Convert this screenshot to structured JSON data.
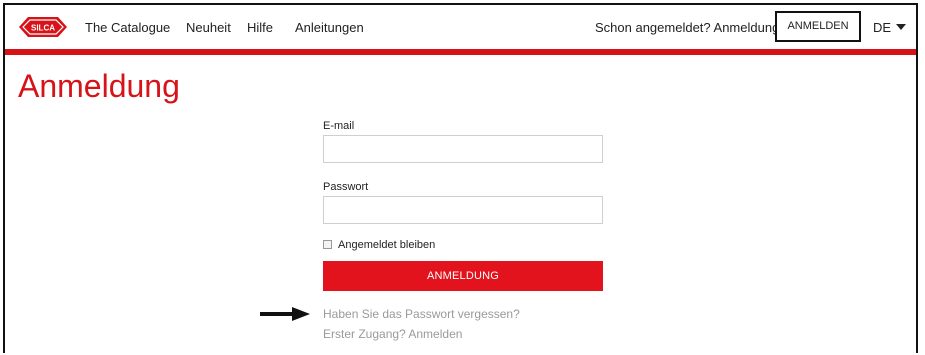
{
  "nav": {
    "logo_text": "SILCA",
    "items": [
      "The Catalogue",
      "Neuheit",
      "Hilfe",
      "Anleitungen"
    ],
    "already_logged": "Schon angemeldet? Anmeldung",
    "login_button": "ANMELDEN",
    "language": "DE"
  },
  "page": {
    "title": "Anmeldung"
  },
  "form": {
    "email_label": "E-mail",
    "email_value": "",
    "password_label": "Passwort",
    "password_value": "",
    "remember_label": "Angemeldet bleiben",
    "remember_checked": false,
    "submit_label": "ANMELDUNG",
    "forgot_link": "Haben Sie das Passwort vergessen?",
    "register_link": "Erster Zugang? Anmelden"
  },
  "colors": {
    "accent": "#d7131a",
    "button": "#e2131c",
    "link_gray": "#9a9a9a"
  }
}
